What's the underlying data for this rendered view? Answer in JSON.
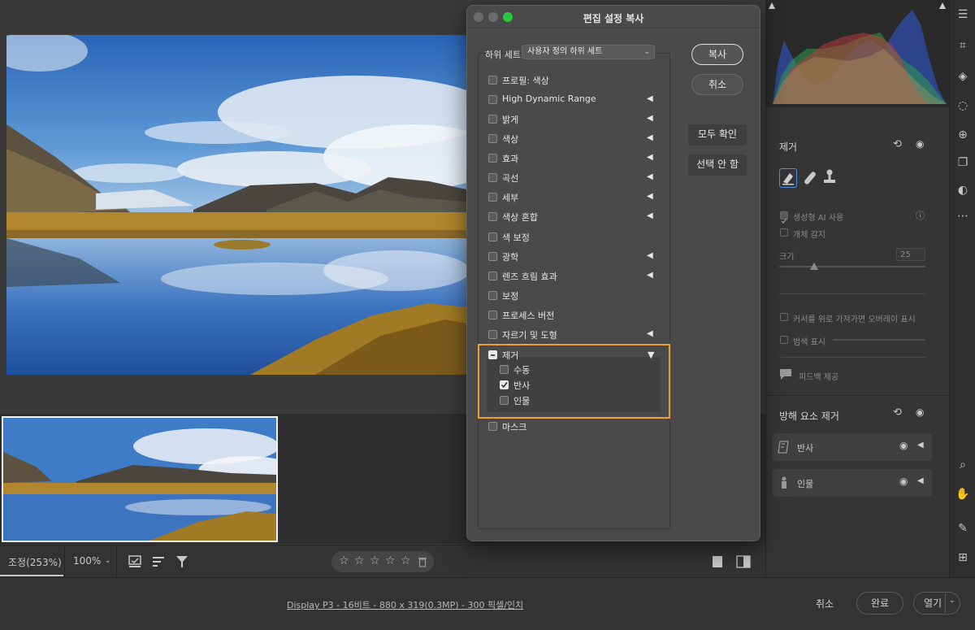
{
  "dialog": {
    "title": "편집 설정 복사",
    "subset_label": "하위 세트:",
    "subset_value": "사용자 정의 하위 세트",
    "buttons": {
      "copy": "복사",
      "cancel": "취소",
      "check_all": "모두 확인",
      "check_none": "선택 안 함"
    },
    "items": [
      {
        "label": "프로필: 색상",
        "checked": false,
        "expandable": false
      },
      {
        "label": "High Dynamic Range",
        "checked": false,
        "expandable": true
      },
      {
        "label": "밝게",
        "checked": false,
        "expandable": true
      },
      {
        "label": "색상",
        "checked": false,
        "expandable": true
      },
      {
        "label": "효과",
        "checked": false,
        "expandable": true
      },
      {
        "label": "곡선",
        "checked": false,
        "expandable": true
      },
      {
        "label": "세부",
        "checked": false,
        "expandable": true
      },
      {
        "label": "색상 혼합",
        "checked": false,
        "expandable": true
      },
      {
        "label": "색 보정",
        "checked": false,
        "expandable": false
      },
      {
        "label": "광학",
        "checked": false,
        "expandable": true
      },
      {
        "label": "렌즈 흐림 효과",
        "checked": false,
        "expandable": true
      },
      {
        "label": "보정",
        "checked": false,
        "expandable": false
      },
      {
        "label": "프로세스 버전",
        "checked": false,
        "expandable": false
      },
      {
        "label": "자르기 및 도형",
        "checked": false,
        "expandable": true
      }
    ],
    "group": {
      "label": "제거",
      "state": "partial",
      "children": [
        {
          "label": "수동",
          "checked": false
        },
        {
          "label": "반사",
          "checked": true
        },
        {
          "label": "인물",
          "checked": false
        }
      ]
    },
    "after_items": [
      {
        "label": "마스크",
        "checked": false
      }
    ]
  },
  "toolbar": {
    "zoom_fit": "조정(253%)",
    "zoom_value": "100%"
  },
  "status": {
    "info": "Display P3 - 16비트 - 880 x 319(0.3MP) - 300 픽셀/인치",
    "cancel": "취소",
    "done": "완료",
    "open": "열기"
  },
  "panel": {
    "remove": {
      "title": "제거",
      "gen_ai": "생성형 AI 사용",
      "detect_objects": "개체 감지",
      "size_label": "크기",
      "size_value": "25",
      "overlay": "커서를 위로 가져가면 오버레이 표시",
      "brush_display": "범색 표시",
      "feedback": "피드백 제공"
    },
    "distraction": {
      "title": "방해 요소 제거",
      "rows": [
        {
          "label": "반사"
        },
        {
          "label": "인물"
        }
      ]
    }
  },
  "colors": {
    "accent_orange": "#f0a030",
    "dialog_bg": "#4a4a4a",
    "close_red": "#5a5a5a",
    "zoom_green": "#27c93f"
  }
}
